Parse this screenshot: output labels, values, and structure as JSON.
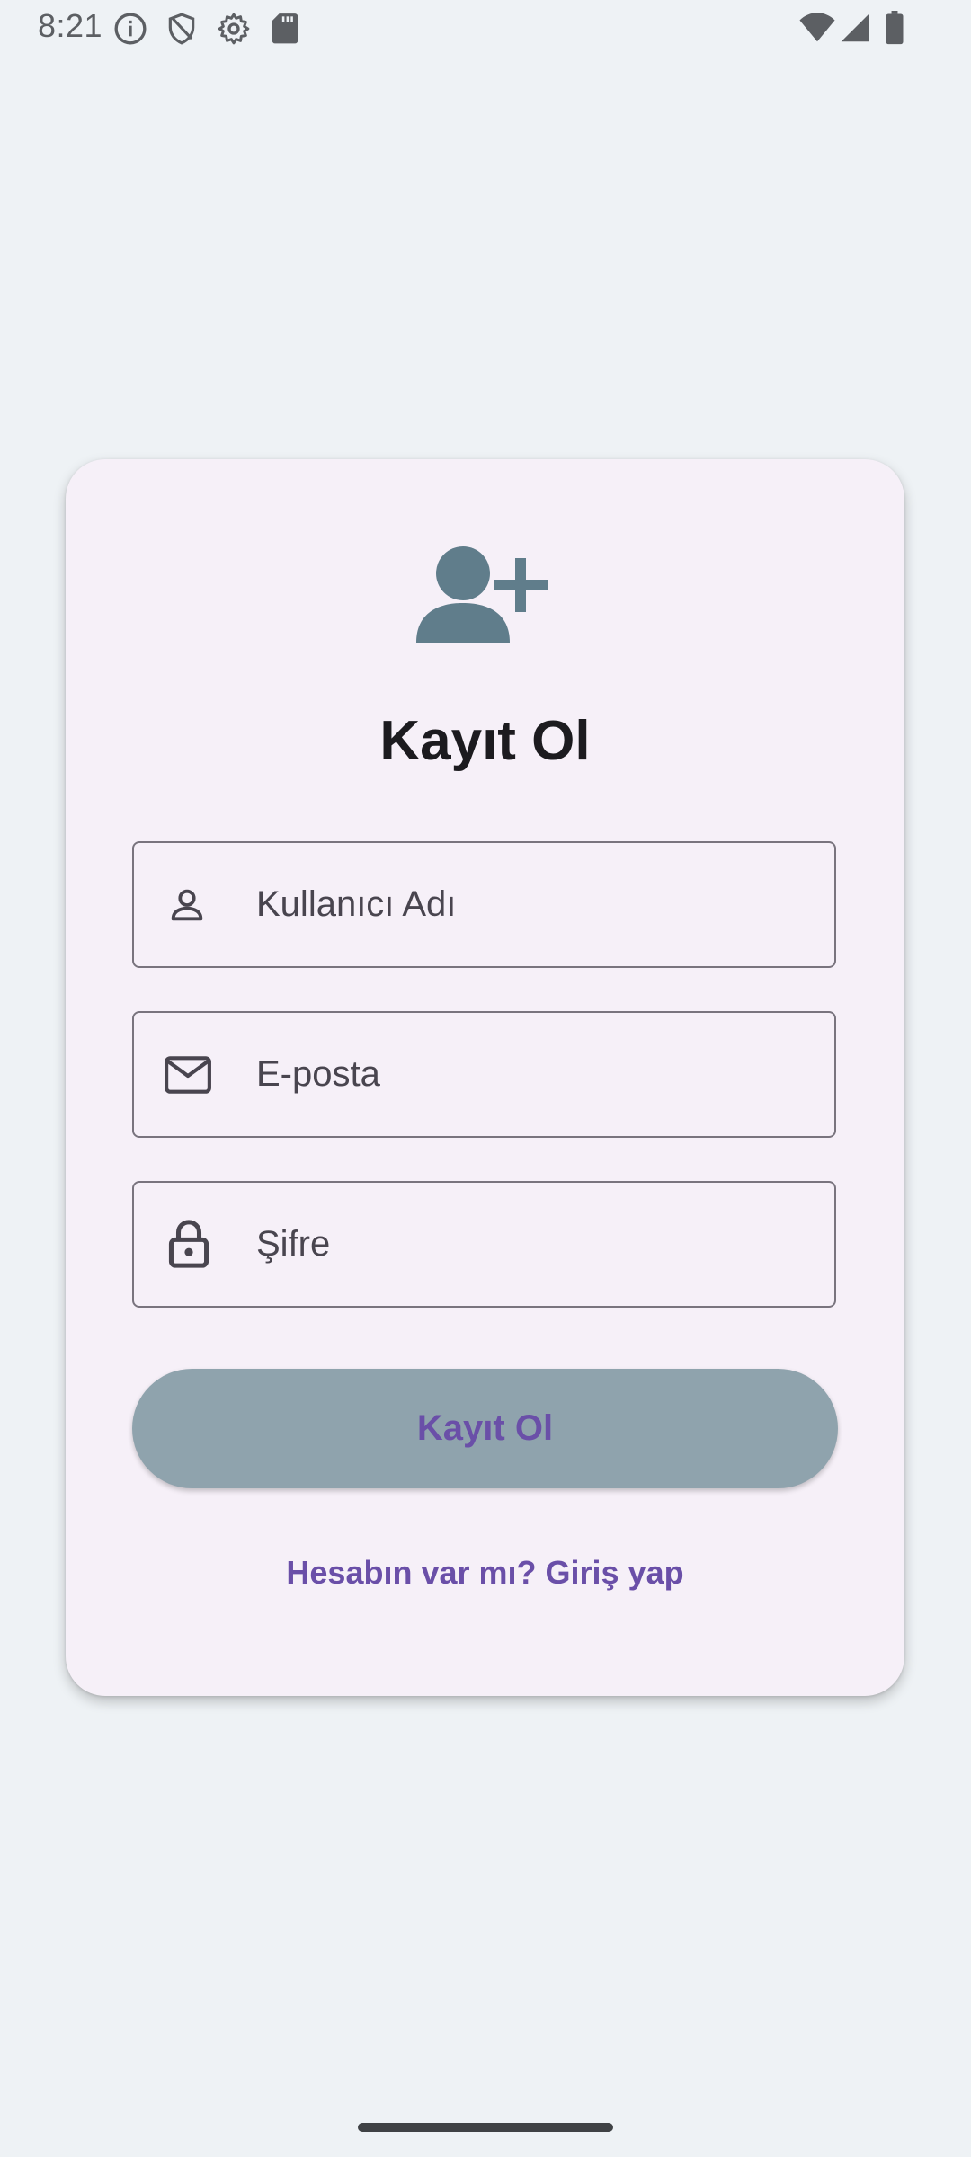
{
  "status_bar": {
    "time": "8:21",
    "icons": [
      "info-icon",
      "shield-icon",
      "settings-icon",
      "sd-card-icon",
      "wifi-icon",
      "signal-icon",
      "battery-icon"
    ]
  },
  "colors": {
    "background": "#eef2f5",
    "card": "#f6f0f8",
    "accent_icon": "#607d8b",
    "button": "#8fa3ad",
    "primary_text": "#6a4fa8"
  },
  "register": {
    "hero_icon": "person-add-icon",
    "title": "Kayıt Ol",
    "fields": {
      "username": {
        "placeholder": "Kullanıcı Adı",
        "value": "",
        "icon": "person-icon"
      },
      "email": {
        "placeholder": "E-posta",
        "value": "",
        "icon": "mail-icon"
      },
      "password": {
        "placeholder": "Şifre",
        "value": "",
        "icon": "lock-icon"
      }
    },
    "submit_label": "Kayıt Ol",
    "login_link": "Hesabın var mı? Giriş yap"
  }
}
